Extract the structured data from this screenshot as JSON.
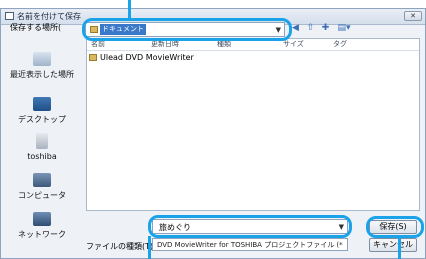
{
  "window": {
    "title": "名前を付けて保存",
    "close_label": "✕"
  },
  "location": {
    "label": "保存する場所(",
    "value": "ドキュメント"
  },
  "toolbar": {
    "icons": [
      "back-icon",
      "up-folder-icon",
      "new-folder-icon",
      "view-menu-icon"
    ]
  },
  "places": [
    {
      "label": "最近表示した場所"
    },
    {
      "label": "デスクトップ"
    },
    {
      "label": "toshiba"
    },
    {
      "label": "コンピュータ"
    },
    {
      "label": "ネットワーク"
    }
  ],
  "columns": [
    "名前",
    "更新日時",
    "種類",
    "サイズ",
    "タグ"
  ],
  "files": [
    {
      "name": "Ulead DVD MovieWriter"
    }
  ],
  "filename": {
    "value": "旅めぐり"
  },
  "filetype": {
    "label": "ファイルの種類(T):",
    "value": "DVD MovieWriter for TOSHIBA プロジェクトファイル (*"
  },
  "buttons": {
    "save": "保存(S)",
    "cancel": "キャンセル"
  }
}
